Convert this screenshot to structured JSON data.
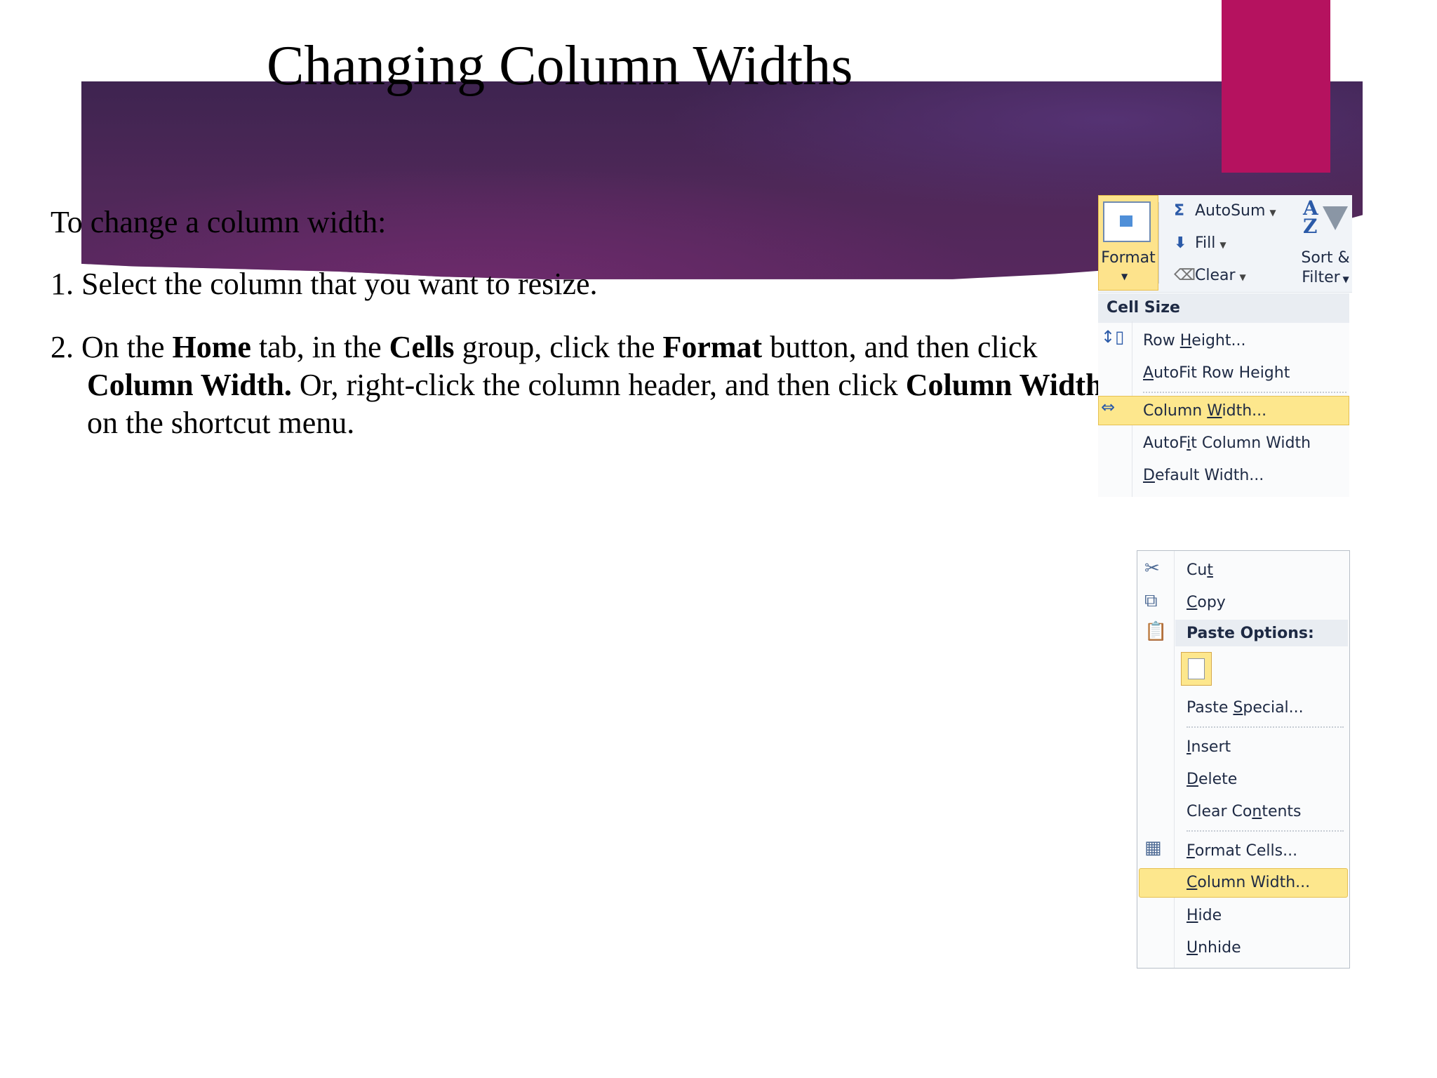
{
  "slide": {
    "title": "Changing Column Widths",
    "intro": "To change a column width:",
    "step1": "1. Select the column that you want to resize.",
    "step2": {
      "t1": "2. On the ",
      "b1": "Home",
      "t2": " tab, in the ",
      "b2": "Cells",
      "t3": " group, click the ",
      "b3": "Format",
      "t4": " button, and then click ",
      "b4": "Column Width.",
      "t5": " Or, right-click the column header, and then click ",
      "b5": "Column Width",
      "t6": " on the shortcut menu."
    }
  },
  "colors": {
    "banner": "#5a2a64",
    "accent": "#b5125f",
    "highlight": "#fde78d"
  },
  "ribbon": {
    "format_label": "Format",
    "autosum_label": "AutoSum",
    "fill_label": "Fill",
    "clear_label": "Clear",
    "sort_label_1": "Sort &",
    "sort_label_2": "Filter",
    "icons": [
      "format-icon",
      "sigma-icon",
      "fill-down-icon",
      "eraser-icon",
      "sort-az-icon",
      "funnel-icon"
    ]
  },
  "format_menu": {
    "section": "Cell Size",
    "items": [
      {
        "pre": "Row ",
        "key": "H",
        "post": "eight..."
      },
      {
        "pre": "",
        "key": "A",
        "post": "utoFit Row Height"
      },
      {
        "pre": "Column ",
        "key": "W",
        "post": "idth..."
      },
      {
        "pre": "AutoF",
        "key": "i",
        "post": "t Column Width"
      },
      {
        "pre": "",
        "key": "D",
        "post": "efault Width..."
      }
    ],
    "highlighted": "Column Width..."
  },
  "context_menu": {
    "items": [
      {
        "pre": "Cu",
        "key": "t",
        "post": ""
      },
      {
        "pre": "",
        "key": "C",
        "post": "opy"
      },
      {
        "pre": "Paste Options:",
        "key": "",
        "post": ""
      },
      {
        "pre": "Paste ",
        "key": "S",
        "post": "pecial..."
      },
      {
        "pre": "",
        "key": "I",
        "post": "nsert"
      },
      {
        "pre": "",
        "key": "D",
        "post": "elete"
      },
      {
        "pre": "Clear Co",
        "key": "n",
        "post": "tents"
      },
      {
        "pre": "",
        "key": "F",
        "post": "ormat Cells..."
      },
      {
        "pre": "",
        "key": "C",
        "post": "olumn Width..."
      },
      {
        "pre": "",
        "key": "H",
        "post": "ide"
      },
      {
        "pre": "",
        "key": "U",
        "post": "nhide"
      }
    ],
    "highlighted": "Column Width...",
    "icons": [
      "scissors-icon",
      "copy-icon",
      "paste-icon",
      "paste-keep-format-icon",
      "format-cells-icon"
    ]
  }
}
